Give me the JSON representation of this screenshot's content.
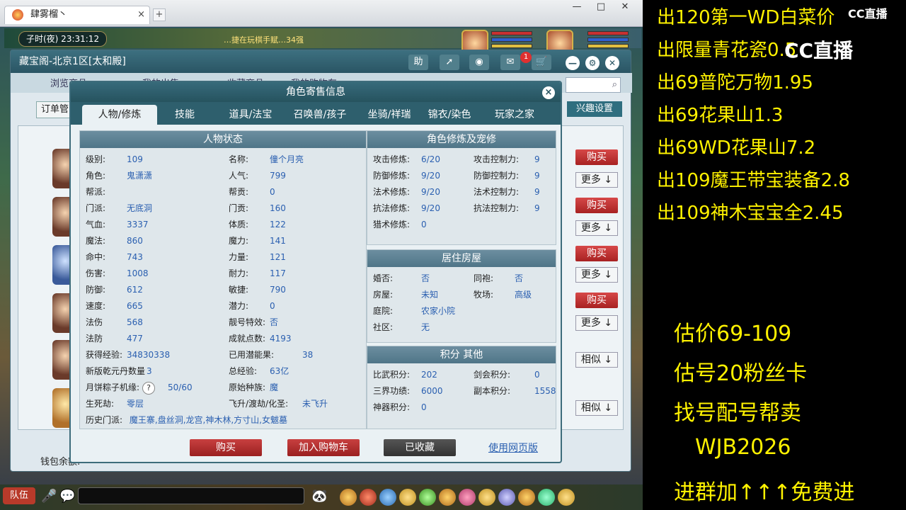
{
  "browser": {
    "tab_title": "肆雾榴丶",
    "tab_close": "×",
    "new_tab": "+"
  },
  "game": {
    "clock": "子时(夜)  23:31:12",
    "marquee": "…捷在玩棋手赋…34强",
    "main_title": "藏宝阁-北京1区[太和殿]",
    "help_btn": "助",
    "mail_badge": "1",
    "nav": [
      "浏览商品",
      "我的出售",
      "收藏商品",
      "我的购物车"
    ],
    "order_btn": "订单管",
    "interest_btn": "兴趣设置",
    "buy_label": "购买",
    "more_label": "更多 ↓",
    "similar_label": "相似 ↓",
    "wallet_label": "钱包余额:",
    "team_btn": "队伍"
  },
  "dialog": {
    "title": "角色寄售信息",
    "close": "×",
    "tabs": [
      "人物/修炼",
      "技能",
      "道具/法宝",
      "召唤兽/孩子",
      "坐骑/祥瑞",
      "锦衣/染色",
      "玩家之家"
    ],
    "status_title": "人物状态",
    "left_col": [
      {
        "k": "级别:",
        "v": "109"
      },
      {
        "k": "角色:",
        "v": "鬼潇潇"
      },
      {
        "k": "帮派:",
        "v": ""
      },
      {
        "k": "门派:",
        "v": "无底洞"
      },
      {
        "k": "气血:",
        "v": "3337"
      },
      {
        "k": "魔法:",
        "v": "860"
      },
      {
        "k": "命中:",
        "v": "743"
      },
      {
        "k": "伤害:",
        "v": "1008"
      },
      {
        "k": "防御:",
        "v": "612"
      },
      {
        "k": "速度:",
        "v": "665"
      },
      {
        "k": "法伤",
        "v": "568"
      },
      {
        "k": "法防",
        "v": "477"
      },
      {
        "k": "获得经验:",
        "v": "34830338"
      },
      {
        "k": "新版乾元丹数量",
        "v": "3"
      },
      {
        "k": "月饼粽子机缘:",
        "v": "50/60"
      },
      {
        "k": "生死劫:",
        "v": "零层"
      }
    ],
    "right_col": [
      {
        "k": "名称:",
        "v": "僮个月亮"
      },
      {
        "k": "人气:",
        "v": "799"
      },
      {
        "k": "帮贡:",
        "v": "0"
      },
      {
        "k": "门贡:",
        "v": "160"
      },
      {
        "k": "体质:",
        "v": "122"
      },
      {
        "k": "魔力:",
        "v": "141"
      },
      {
        "k": "力量:",
        "v": "121"
      },
      {
        "k": "耐力:",
        "v": "117"
      },
      {
        "k": "敏捷:",
        "v": "790"
      },
      {
        "k": "潜力:",
        "v": "0"
      },
      {
        "k": "靓号特效:",
        "v": "否"
      },
      {
        "k": "成就点数:",
        "v": "4193"
      },
      {
        "k": "已用潜能果:",
        "v": "38"
      },
      {
        "k": "总经验:",
        "v": "63亿"
      },
      {
        "k": "原始种族:",
        "v": "魔"
      },
      {
        "k": "飞升/渡劫/化圣:",
        "v": "未飞升"
      }
    ],
    "history_label": "历史门派:",
    "history_value": "魔王寨,盘丝洞,龙宫,神木林,方寸山,女魃墓",
    "question_mark": "?",
    "cultivation_title": "角色修炼及宠修",
    "cultivation": [
      {
        "k1": "攻击修炼:",
        "v1": "6/20",
        "k2": "攻击控制力:",
        "v2": "9"
      },
      {
        "k1": "防御修炼:",
        "v1": "9/20",
        "k2": "防御控制力:",
        "v2": "9"
      },
      {
        "k1": "法术修炼:",
        "v1": "9/20",
        "k2": "法术控制力:",
        "v2": "9"
      },
      {
        "k1": "抗法修炼:",
        "v1": "9/20",
        "k2": "抗法控制力:",
        "v2": "9"
      },
      {
        "k1": "猎术修炼:",
        "v1": "0",
        "k2": "",
        "v2": ""
      }
    ],
    "house_title": "居住房屋",
    "house": [
      {
        "k1": "婚否:",
        "v1": "否",
        "k2": "同袍:",
        "v2": "否"
      },
      {
        "k1": "房屋:",
        "v1": "未知",
        "k2": "牧场:",
        "v2": "高级"
      },
      {
        "k1": "庭院:",
        "v1": "农家小院",
        "k2": "",
        "v2": ""
      },
      {
        "k1": "社区:",
        "v1": "无",
        "k2": "",
        "v2": ""
      }
    ],
    "score_title": "积分 其他",
    "score": [
      {
        "k1": "比武积分:",
        "v1": "202",
        "k2": "剑会积分:",
        "v2": "0"
      },
      {
        "k1": "三界功绩:",
        "v1": "6000",
        "k2": "副本积分:",
        "v2": "1558"
      },
      {
        "k1": "神器积分:",
        "v1": "0",
        "k2": "",
        "v2": ""
      }
    ],
    "buttons": {
      "buy": "购买",
      "cart": "加入购物车",
      "fav": "已收藏",
      "web": "使用网页版"
    }
  },
  "stream": {
    "lines": [
      "出120第一WD白菜价",
      "出限量青花瓷0.5",
      "出69普陀万物1.95",
      "出69花果山1.3",
      "出69WD花果山7.2",
      "出109魔王带宝装备2.8",
      "出109神木宝宝全2.45"
    ],
    "promo": [
      "估价69-109",
      "估号20粉丝卡",
      "找号配号帮卖",
      "WJB2026",
      "进群加↑↑↑免费进"
    ],
    "logo_small": "CC直播",
    "logo_big": "CC直播"
  },
  "colors": {
    "accent": "#2e5f6d",
    "value_blue": "#2a5fb0",
    "buy_red": "#c03030",
    "stream_yellow": "#fff200"
  }
}
